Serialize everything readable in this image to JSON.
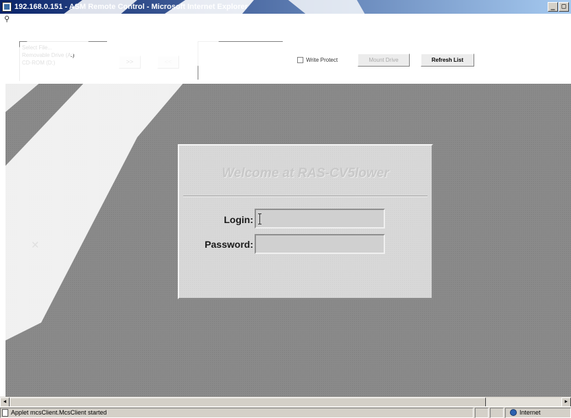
{
  "window": {
    "title": "192.168.0.151 - ASM Remote Control - Microsoft Internet Explorer",
    "minimize": "_",
    "maximize": "□"
  },
  "toolbar": {
    "drive_list": [
      "Select File...",
      "Removable Drive (A:)",
      "CD-ROM (D:)"
    ],
    "move_right_label": ">>",
    "move_left_label": "<<",
    "write_protect_label": "Write Protect",
    "mount_drive_label": "Mount Drive",
    "refresh_label": "Refresh List"
  },
  "remote": {
    "close_glyph": "✕",
    "dialog": {
      "welcome": "Welcome at RAS-CV5lower",
      "login_label": "Login:",
      "password_label": "Password:",
      "login_value": "",
      "password_value": ""
    }
  },
  "scrollbar": {
    "left_arrow": "◄",
    "right_arrow": "►"
  },
  "status": {
    "message": "Applet mcsClient.McsClient started",
    "zone": "Internet"
  },
  "colors": {
    "title_bar": "#0a246a",
    "remote_bg": "#8a8a8a",
    "dialog_bg": "#d8d8d8"
  }
}
